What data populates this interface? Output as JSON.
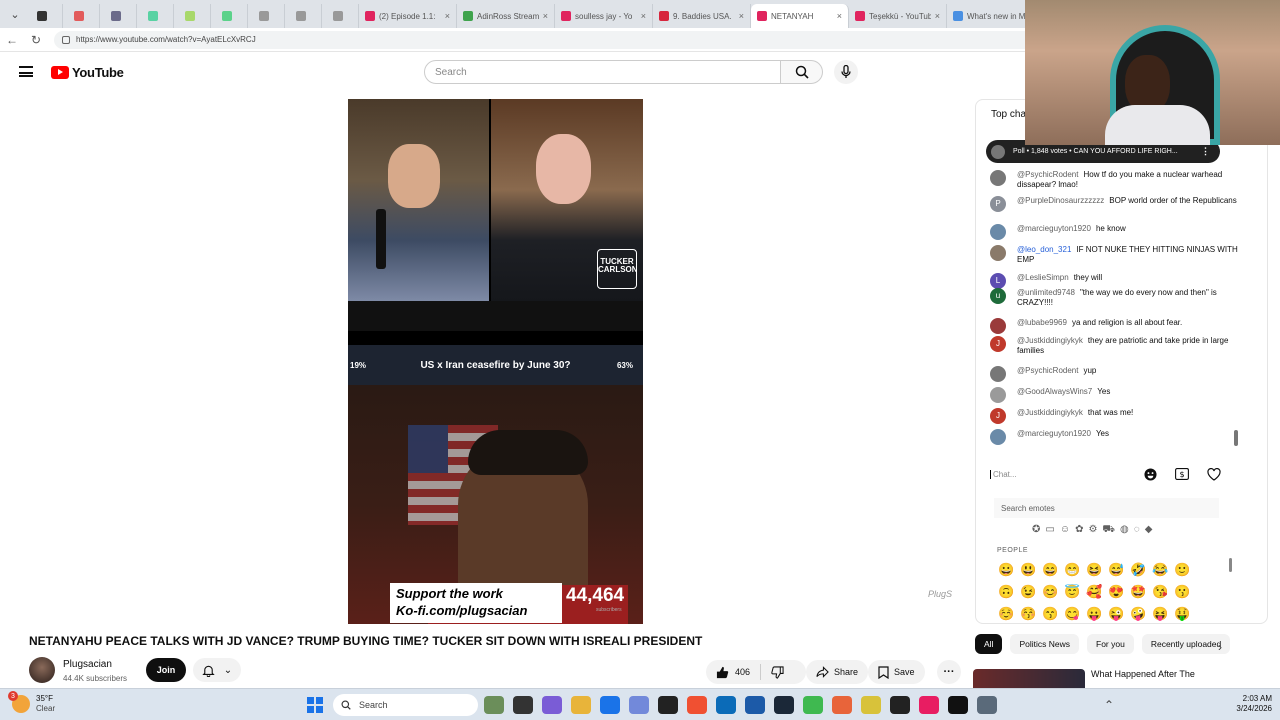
{
  "browser": {
    "tabs": [
      {
        "label": "",
        "color": "#333333",
        "icon_only": true
      },
      {
        "label": "",
        "color": "#e25b5b",
        "icon_only": true
      },
      {
        "label": "",
        "color": "#6b6b8a",
        "icon_only": true
      },
      {
        "label": "",
        "color": "#59d2a3",
        "icon_only": true
      },
      {
        "label": "",
        "color": "#a8d86a",
        "icon_only": true
      },
      {
        "label": "",
        "color": "#5bd28a",
        "icon_only": true
      },
      {
        "label": "",
        "color": "#999999",
        "icon_only": true
      },
      {
        "label": "",
        "color": "#999999",
        "icon_only": true
      },
      {
        "label": "",
        "color": "#999999",
        "icon_only": true
      },
      {
        "label": "(2) Episode 1.1:",
        "color": "#e0245e",
        "icon_only": false
      },
      {
        "label": "AdinRoss Stream",
        "color": "#3fa34d",
        "icon_only": false
      },
      {
        "label": "soulless jay - Yo",
        "color": "#e0245e",
        "icon_only": false
      },
      {
        "label": "9. Baddies USA.",
        "color": "#d7263d",
        "icon_only": false
      },
      {
        "label": "NETANYAH",
        "color": "#e0245e",
        "icon_only": false,
        "active": true
      },
      {
        "label": "Teşekkü - YouTub",
        "color": "#e0245e",
        "icon_only": false
      },
      {
        "label": "What's new in M",
        "color": "#4a90e2",
        "icon_only": false
      }
    ],
    "url": "https://www.youtube.com/watch?v=AyatELcXvRCJ"
  },
  "header": {
    "logo_text": "YouTube",
    "search_placeholder": "Search"
  },
  "video": {
    "poll_overlay": "US x Iran ceasefire by June 30?",
    "poll_left_pct": "19%",
    "poll_right_pct": "63%",
    "watermark": "TUCKER CARLSON",
    "support_line1": "Support the work",
    "support_line2": "Ko-fi.com/plugsacian",
    "subscriber_count": "44,464",
    "subscriber_label": "subscribers"
  },
  "title": "NETANYAHU PEACE TALKS WITH JD VANCE? TRUMP BUYING TIME? TUCKER SIT DOWN WITH ISREALI PRESIDENT",
  "channel": {
    "name": "Plugsacian",
    "subscribers": "44.4K subscribers",
    "join_label": "Join"
  },
  "actions": {
    "likes": "406",
    "share_label": "Share",
    "save_label": "Save"
  },
  "chat": {
    "header": "Top chat",
    "poll_banner": "Poll • 1,848 votes • CAN YOU AFFORD LIFE RIGH...",
    "messages": [
      {
        "author": "@PsychicRodent",
        "text": "How tf do you make a nuclear warhead dissapear? lmao!",
        "avatar_color": "#777777",
        "avatar_letter": "",
        "blue": false
      },
      {
        "author": "@PurpleDinosaurzzzzzz",
        "text": "BOP world order of the Republicans",
        "avatar_color": "#8a8f98",
        "avatar_letter": "P",
        "blue": false
      },
      {
        "author": "@marcieguyton1920",
        "text": "he know",
        "avatar_color": "#6a8aa8",
        "avatar_letter": "",
        "blue": false
      },
      {
        "author": "@leo_don_321",
        "text": "IF NOT NUKE THEY HITTING NINJAS WITH EMP",
        "avatar_color": "#8a7a6a",
        "avatar_letter": "",
        "blue": true
      },
      {
        "author": "@LeslieSimpn",
        "text": "they will",
        "avatar_color": "#5c4db1",
        "avatar_letter": "L",
        "blue": false
      },
      {
        "author": "@unlimited9748",
        "text": "\"the way we do every now and then\" is CRAZY!!!!",
        "avatar_color": "#1e6b3a",
        "avatar_letter": "u",
        "blue": false
      },
      {
        "author": "@lubabe9969",
        "text": "ya and religion is all about fear.",
        "avatar_color": "#9a3a3a",
        "avatar_letter": "",
        "blue": false
      },
      {
        "author": "@Justkiddingiykyk",
        "text": "they are patriotic and take pride in large families",
        "avatar_color": "#c0392b",
        "avatar_letter": "J",
        "blue": false
      },
      {
        "author": "@PsychicRodent",
        "text": "yup",
        "avatar_color": "#777777",
        "avatar_letter": "",
        "blue": false
      },
      {
        "author": "@GoodAlwaysWins7",
        "text": "Yes",
        "avatar_color": "#9a9a9a",
        "avatar_letter": "",
        "blue": false
      },
      {
        "author": "@Justkiddingiykyk",
        "text": "that was me!",
        "avatar_color": "#c0392b",
        "avatar_letter": "J",
        "blue": false
      },
      {
        "author": "@marcieguyton1920",
        "text": "Yes",
        "avatar_color": "#6a8aa8",
        "avatar_letter": "",
        "blue": false
      }
    ],
    "input_placeholder": "Chat...",
    "emote_search_placeholder": "Search emotes",
    "emote_section": "PEOPLE",
    "emotes": [
      "😀",
      "😃",
      "😄",
      "😁",
      "😆",
      "😅",
      "🤣",
      "😂",
      "🙂",
      "🙃",
      "😉",
      "😊",
      "😇",
      "🥰",
      "😍",
      "🤩",
      "😘",
      "😗",
      "☺️",
      "😚",
      "😙",
      "😋",
      "😛",
      "😜",
      "🤪",
      "😝",
      "🤑"
    ]
  },
  "chips": [
    "All",
    "Politics News",
    "For you",
    "Recently uploaded"
  ],
  "recommended": {
    "title": "What Happened After The"
  },
  "taskbar": {
    "temperature": "35°F",
    "condition": "Clear",
    "weather_badge": "3",
    "search_label": "Search",
    "time": "2:03 AM",
    "date": "3/24/2026"
  },
  "overlay": {
    "signature": "PlugS"
  }
}
